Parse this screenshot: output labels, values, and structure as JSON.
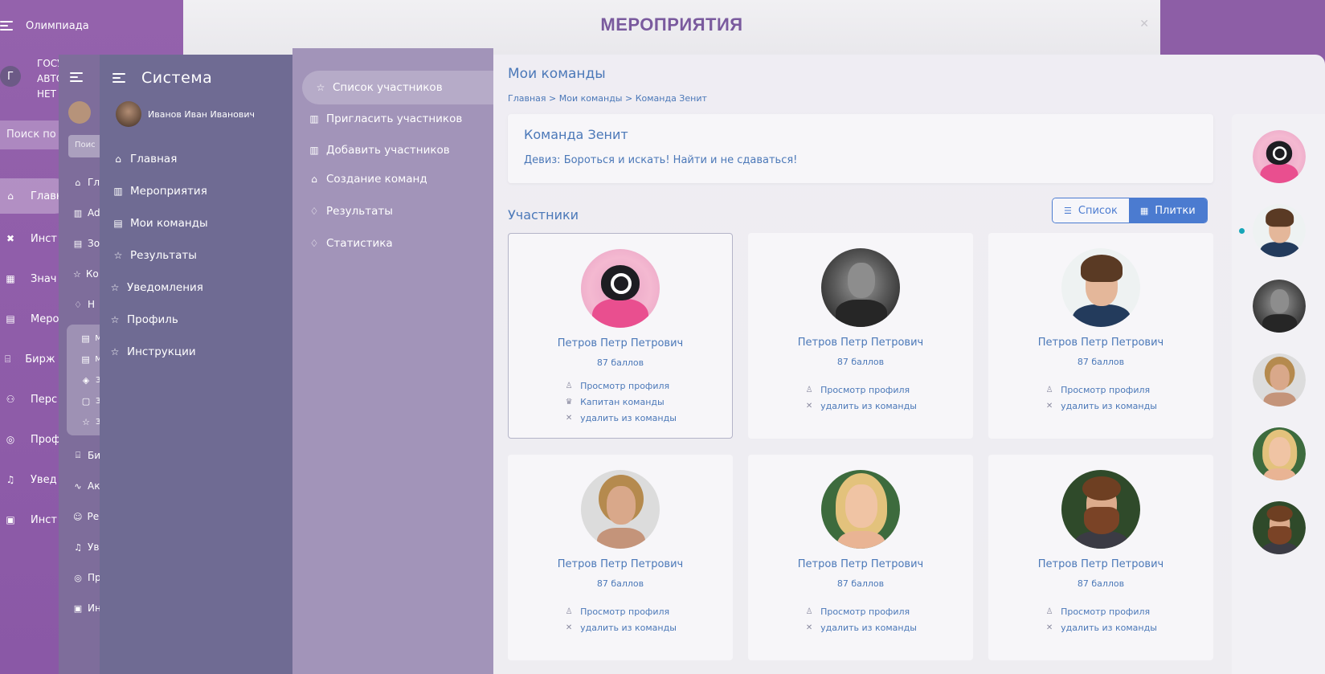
{
  "back_app": {
    "title": "Олимпиада",
    "avatar_letter": "Г",
    "org_lines": [
      "ГОСУ",
      "АВТО",
      "НЕТ"
    ],
    "search_placeholder": "Поиск по к",
    "nav": [
      {
        "icon": "home-icon",
        "label": "Главн",
        "active": true
      },
      {
        "icon": "tools-icon",
        "label": "Инст",
        "active": false
      },
      {
        "icon": "badge-icon",
        "label": "Знач",
        "active": false
      },
      {
        "icon": "calendar-icon",
        "label": "Меро",
        "active": false
      },
      {
        "icon": "bank-icon",
        "label": "Бирж мер",
        "active": false
      },
      {
        "icon": "people-icon",
        "label": "Перс",
        "active": false
      },
      {
        "icon": "profile-icon",
        "label": "Проф",
        "active": false
      },
      {
        "icon": "bell-icon",
        "label": "Увед",
        "active": false
      },
      {
        "icon": "doc-icon",
        "label": "Инст",
        "active": false
      }
    ]
  },
  "back_window": {
    "title": "МЕРОПРИЯТИЯ"
  },
  "mid_sidebar": {
    "search_placeholder": "Поис",
    "items": [
      {
        "icon": "home-icon",
        "label": "Гл"
      },
      {
        "icon": "map-icon",
        "label": "Ad"
      },
      {
        "icon": "list-icon",
        "label": "Зо"
      },
      {
        "icon": "star-icon",
        "label": "Ко зн"
      },
      {
        "icon": "diamond-icon",
        "label": "Н"
      }
    ],
    "box_items": [
      {
        "icon": "calendar-icon",
        "label": "Ме"
      },
      {
        "icon": "list-icon",
        "label": "Мо"
      },
      {
        "icon": "box-icon",
        "label": "За"
      },
      {
        "icon": "doc-icon",
        "label": "За"
      },
      {
        "icon": "star-icon",
        "label": "Зн"
      }
    ],
    "items_after": [
      {
        "icon": "bank-icon",
        "label": "Би"
      },
      {
        "icon": "activity-icon",
        "label": "Ак"
      },
      {
        "icon": "smile-icon",
        "label": "Ре ge"
      },
      {
        "icon": "bell-icon",
        "label": "Ув"
      },
      {
        "icon": "profile-icon",
        "label": "Пр"
      },
      {
        "icon": "doc-icon",
        "label": "Ин"
      }
    ]
  },
  "sidebar": {
    "title": "Система",
    "user_name": "Иванов Иван Иванович",
    "items": [
      {
        "icon": "home-icon",
        "label": "Главная"
      },
      {
        "icon": "map-icon",
        "label": "Мероприятия"
      },
      {
        "icon": "list-icon",
        "label": "Мои команды"
      },
      {
        "icon": "star-icon",
        "label": "Результаты"
      },
      {
        "icon": "star-icon",
        "label": "Уведомления"
      },
      {
        "icon": "star-icon",
        "label": "Профиль"
      },
      {
        "icon": "star-icon",
        "label": "Инструкции"
      }
    ]
  },
  "submenu": {
    "items": [
      {
        "icon": "star-icon",
        "label": "Список участников",
        "active": true
      },
      {
        "icon": "map-icon",
        "label": "Пригласить участников",
        "active": false
      },
      {
        "icon": "map-icon",
        "label": "Добавить участников",
        "active": false
      },
      {
        "icon": "home-icon",
        "label": "Создание команд",
        "active": false
      },
      {
        "icon": "diamond-icon",
        "label": "Результаты",
        "active": false
      },
      {
        "icon": "diamond-icon",
        "label": "Статистика",
        "active": false
      }
    ]
  },
  "main": {
    "page_title": "Мои команды",
    "breadcrumb": "Главная > Мои команды > Команда Зенит",
    "team_name": "Команда Зенит",
    "team_motto": "Девиз: Бороться и искать! Найти и не сдаваться!",
    "section_title": "Участники",
    "view_list_label": "Список",
    "view_tiles_label": "Плитки",
    "members": [
      {
        "name": "Петров Петр Петрович",
        "score": "87 баллов",
        "photo": "mask",
        "selected": true,
        "actions": [
          {
            "icon": "user-icon",
            "label": "Просмотр профиля"
          },
          {
            "icon": "crown-icon",
            "label": "Капитан команды"
          },
          {
            "icon": "close-icon",
            "label": "удалить из команды"
          }
        ]
      },
      {
        "name": "Петров Петр Петрович",
        "score": "87 баллов",
        "photo": "bw",
        "selected": false,
        "actions": [
          {
            "icon": "user-icon",
            "label": "Просмотр профиля"
          },
          {
            "icon": "close-icon",
            "label": "удалить из команды"
          }
        ]
      },
      {
        "name": "Петров Петр Петрович",
        "score": "87 баллов",
        "photo": "boy",
        "selected": false,
        "actions": [
          {
            "icon": "user-icon",
            "label": "Просмотр профиля"
          },
          {
            "icon": "close-icon",
            "label": "удалить из команды"
          }
        ]
      },
      {
        "name": "Петров Петр Петрович",
        "score": "87 баллов",
        "photo": "blond1",
        "selected": false,
        "actions": [
          {
            "icon": "user-icon",
            "label": "Просмотр профиля"
          },
          {
            "icon": "close-icon",
            "label": "удалить из команды"
          }
        ]
      },
      {
        "name": "Петров Петр Петрович",
        "score": "87 баллов",
        "photo": "blond2",
        "selected": false,
        "actions": [
          {
            "icon": "user-icon",
            "label": "Просмотр профиля"
          },
          {
            "icon": "close-icon",
            "label": "удалить из команды"
          }
        ]
      },
      {
        "name": "Петров Петр Петрович",
        "score": "87 баллов",
        "photo": "beard",
        "selected": false,
        "actions": [
          {
            "icon": "user-icon",
            "label": "Просмотр профиля"
          },
          {
            "icon": "close-icon",
            "label": "удалить из команды"
          }
        ]
      }
    ]
  },
  "strip": {
    "photos": [
      "mask",
      "boy",
      "bw",
      "blond1",
      "blond2",
      "beard"
    ]
  },
  "colors": {
    "accent": "#4b7bd0",
    "text": "#4b78b8",
    "sidebar": "#6f6b93",
    "submenu": "#a294b9",
    "online_dot": "#17a6b8"
  }
}
